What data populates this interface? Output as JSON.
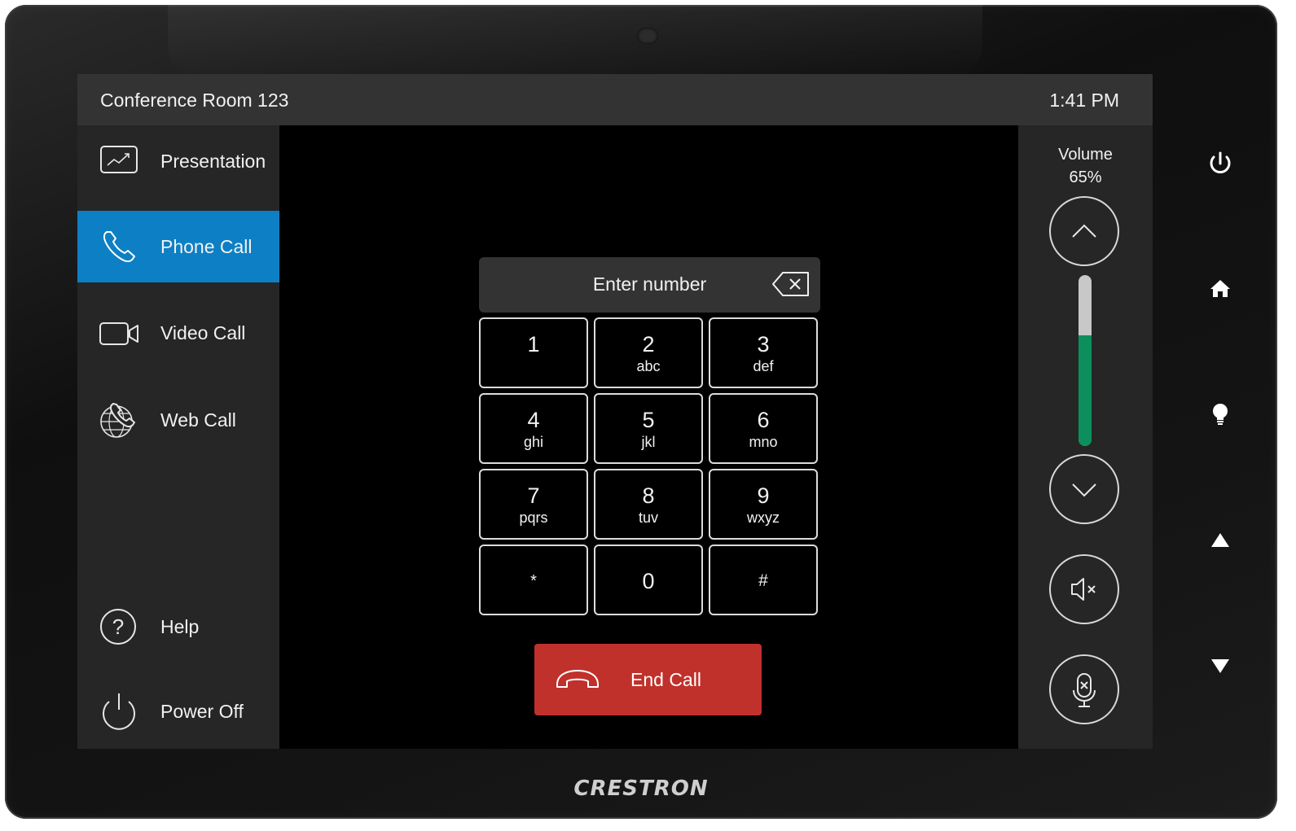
{
  "header": {
    "room_name": "Conference Room 123",
    "time": "1:41 PM"
  },
  "sidebar": {
    "items": [
      {
        "label": "Presentation",
        "icon": "presentation-icon",
        "active": false
      },
      {
        "label": "Phone Call",
        "icon": "phone-icon",
        "active": true
      },
      {
        "label": "Video Call",
        "icon": "video-camera-icon",
        "active": false
      },
      {
        "label": "Web Call",
        "icon": "globe-phone-icon",
        "active": false
      }
    ],
    "bottom_items": [
      {
        "label": "Help",
        "icon": "help-icon"
      },
      {
        "label": "Power Off",
        "icon": "power-icon"
      }
    ],
    "active_color": "#0d7fc5"
  },
  "dialer": {
    "placeholder": "Enter number",
    "keys": [
      {
        "digit": "1",
        "letters": ""
      },
      {
        "digit": "2",
        "letters": "abc"
      },
      {
        "digit": "3",
        "letters": "def"
      },
      {
        "digit": "4",
        "letters": "ghi"
      },
      {
        "digit": "5",
        "letters": "jkl"
      },
      {
        "digit": "6",
        "letters": "mno"
      },
      {
        "digit": "7",
        "letters": "pqrs"
      },
      {
        "digit": "8",
        "letters": "tuv"
      },
      {
        "digit": "9",
        "letters": "wxyz"
      },
      {
        "digit": "*",
        "letters": ""
      },
      {
        "digit": "0",
        "letters": ""
      },
      {
        "digit": "#",
        "letters": ""
      }
    ],
    "end_call_label": "End Call",
    "end_call_color": "#c0312b"
  },
  "volume": {
    "title": "Volume",
    "percent_label": "65%",
    "level": 0.65,
    "bar_color": "#0c8f5c"
  },
  "device": {
    "brand": "CRESTRON",
    "hardware_buttons": [
      "power-icon",
      "home-icon",
      "lightbulb-icon",
      "up-arrow-icon",
      "down-arrow-icon"
    ]
  }
}
